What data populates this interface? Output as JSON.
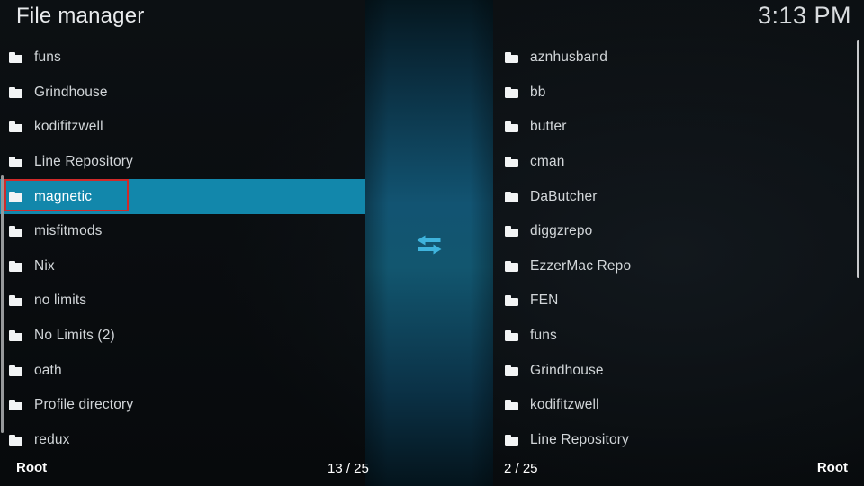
{
  "header": {
    "title": "File manager",
    "clock": "3:13 PM"
  },
  "center": {
    "transfer_icon": "left-right-arrows-icon"
  },
  "colors": {
    "selection": "#1287ab",
    "annotation": "#d12a2a",
    "center_band": "#125472",
    "text": "#d2d6d9",
    "background": "#0a0d10"
  },
  "left_panel": {
    "selected_index": 4,
    "items": [
      {
        "name": "funs",
        "icon": "folder-icon"
      },
      {
        "name": "Grindhouse",
        "icon": "folder-icon"
      },
      {
        "name": "kodifitzwell",
        "icon": "folder-icon"
      },
      {
        "name": "Line Repository",
        "icon": "folder-icon"
      },
      {
        "name": "magnetic",
        "icon": "folder-icon"
      },
      {
        "name": "misfitmods",
        "icon": "folder-icon"
      },
      {
        "name": "Nix",
        "icon": "folder-icon"
      },
      {
        "name": "no limits",
        "icon": "folder-icon"
      },
      {
        "name": "No Limits (2)",
        "icon": "folder-icon"
      },
      {
        "name": "oath",
        "icon": "folder-icon"
      },
      {
        "name": "Profile directory",
        "icon": "folder-icon"
      },
      {
        "name": "redux",
        "icon": "folder-icon"
      }
    ],
    "footer": {
      "path": "Root",
      "count": "13 / 25"
    }
  },
  "right_panel": {
    "selected_index": -1,
    "items": [
      {
        "name": "aznhusband",
        "icon": "folder-icon"
      },
      {
        "name": "bb",
        "icon": "folder-icon"
      },
      {
        "name": "butter",
        "icon": "folder-icon"
      },
      {
        "name": "cman",
        "icon": "folder-icon"
      },
      {
        "name": "DaButcher",
        "icon": "folder-icon"
      },
      {
        "name": "diggzrepo",
        "icon": "folder-icon"
      },
      {
        "name": "EzzerMac Repo",
        "icon": "folder-icon"
      },
      {
        "name": "FEN",
        "icon": "folder-icon"
      },
      {
        "name": "funs",
        "icon": "folder-icon"
      },
      {
        "name": "Grindhouse",
        "icon": "folder-icon"
      },
      {
        "name": "kodifitzwell",
        "icon": "folder-icon"
      },
      {
        "name": "Line Repository",
        "icon": "folder-icon"
      }
    ],
    "footer": {
      "path": "Root",
      "count": "2 / 25"
    }
  }
}
